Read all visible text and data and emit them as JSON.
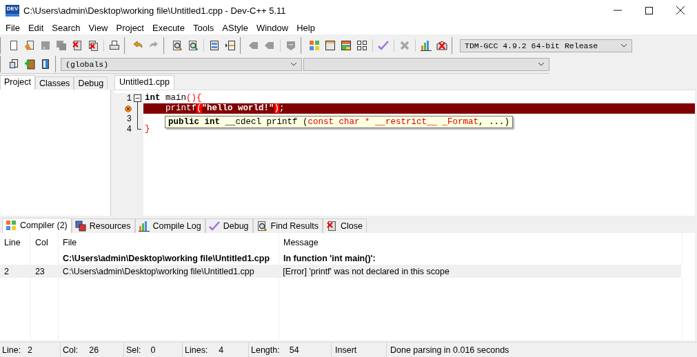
{
  "window": {
    "logo": "DEV",
    "title": "C:\\Users\\admin\\Desktop\\working file\\Untitled1.cpp - Dev-C++ 5.11"
  },
  "menu": [
    "File",
    "Edit",
    "Search",
    "View",
    "Project",
    "Execute",
    "Tools",
    "AStyle",
    "Window",
    "Help"
  ],
  "toolbar": {
    "groups": [
      [
        {
          "kind": "new",
          "disabled": false
        },
        {
          "kind": "open",
          "disabled": false
        },
        {
          "kind": "save",
          "disabled": true
        },
        {
          "kind": "saveall",
          "disabled": true
        },
        {
          "kind": "close",
          "disabled": false
        },
        {
          "kind": "closeall",
          "disabled": false
        },
        {
          "kind": "sep"
        },
        {
          "kind": "print",
          "disabled": false
        }
      ],
      [
        {
          "kind": "undo",
          "disabled": false
        },
        {
          "kind": "redo",
          "disabled": true
        }
      ],
      [
        {
          "kind": "find",
          "disabled": false
        },
        {
          "kind": "replace",
          "disabled": false
        },
        {
          "kind": "sep"
        },
        {
          "kind": "goto",
          "disabled": false
        },
        {
          "kind": "bookmark",
          "disabled": false
        }
      ],
      [
        {
          "kind": "indent",
          "disabled": true
        },
        {
          "kind": "unindent",
          "disabled": true
        },
        {
          "kind": "sep"
        },
        {
          "kind": "comment",
          "disabled": true
        }
      ],
      [
        {
          "kind": "compile",
          "disabled": false
        },
        {
          "kind": "run",
          "disabled": false
        },
        {
          "kind": "compilerun",
          "disabled": false
        },
        {
          "kind": "rebuild",
          "disabled": false
        },
        {
          "kind": "sep"
        },
        {
          "kind": "check",
          "disabled": false
        },
        {
          "kind": "sep"
        },
        {
          "kind": "stop",
          "disabled": true
        },
        {
          "kind": "sep"
        },
        {
          "kind": "profile",
          "disabled": false
        },
        {
          "kind": "delprofile",
          "disabled": false
        }
      ]
    ],
    "compiler": "TDM-GCC 4.9.2 64-bit Release",
    "row2": [
      {
        "kind": "newproj",
        "disabled": false
      },
      {
        "kind": "addfile",
        "disabled": false
      },
      {
        "kind": "book",
        "disabled": false
      }
    ],
    "scope": "(globals)"
  },
  "side_tabs": [
    {
      "label": "Project",
      "selected": true
    },
    {
      "label": "Classes",
      "selected": false
    },
    {
      "label": "Debug",
      "selected": false
    }
  ],
  "editor": {
    "tab": "Untitled1.cpp",
    "fold_expanded": true,
    "lines": [
      {
        "number": "1",
        "error": false,
        "tokens": [
          {
            "kind": "keyword",
            "text": "int"
          },
          {
            "kind": "plain",
            "text": " main"
          },
          {
            "kind": "symbol",
            "text": "(){"
          }
        ]
      },
      {
        "error": true,
        "tokens": [
          {
            "kind": "plain",
            "text": "    printf"
          },
          {
            "kind": "match",
            "text": "("
          },
          {
            "kind": "string",
            "text": "\"hello world!\""
          },
          {
            "kind": "match",
            "text": ")"
          },
          {
            "kind": "symbol",
            "text": ";"
          }
        ]
      },
      {
        "number": "3",
        "error": false
      },
      {
        "number": "4",
        "error": false,
        "tokens": [
          {
            "kind": "symbol",
            "text": "}"
          }
        ]
      }
    ],
    "hint": [
      {
        "kind": "keyword",
        "text": "public"
      },
      {
        "kind": "keyword",
        "text": " int"
      },
      {
        "kind": "plain",
        "text": " __cdecl printf ("
      },
      {
        "kind": "param",
        "text": "const char * __restrict__ _Format"
      },
      {
        "kind": "plain",
        "text": ", ...)"
      }
    ]
  },
  "bottom_tabs": [
    {
      "kind": "compiler",
      "label": "Compiler (2)",
      "selected": true
    },
    {
      "kind": "resources",
      "label": "Resources",
      "selected": false
    },
    {
      "kind": "log",
      "label": "Compile Log",
      "selected": false
    },
    {
      "kind": "debug",
      "label": "Debug",
      "selected": false
    },
    {
      "kind": "find",
      "label": "Find Results",
      "selected": false
    },
    {
      "kind": "close",
      "label": "Close",
      "selected": false
    }
  ],
  "table": {
    "columns": [
      "Line",
      "Col",
      "File",
      "Message"
    ],
    "rows": [
      {
        "bold": true,
        "selected": false,
        "cells": [
          "",
          "",
          "C:\\Users\\admin\\Desktop\\working file\\Untitled1.cpp",
          "In function 'int main()':"
        ]
      },
      {
        "bold": false,
        "selected": true,
        "cells": [
          "2",
          "23",
          "C:\\Users\\admin\\Desktop\\working file\\Untitled1.cpp",
          "[Error] 'printf' was not declared in this scope"
        ]
      }
    ]
  },
  "status_bar": {
    "fields": [
      {
        "label": "Line:",
        "value": "2"
      },
      {
        "label": "Col:",
        "value": "26"
      },
      {
        "label": "Sel:",
        "value": "0"
      },
      {
        "label": "Lines:",
        "value": "4"
      },
      {
        "label": "Length:",
        "value": "54"
      }
    ],
    "mode": "Insert",
    "message": "Done parsing in 0.016 seconds"
  }
}
